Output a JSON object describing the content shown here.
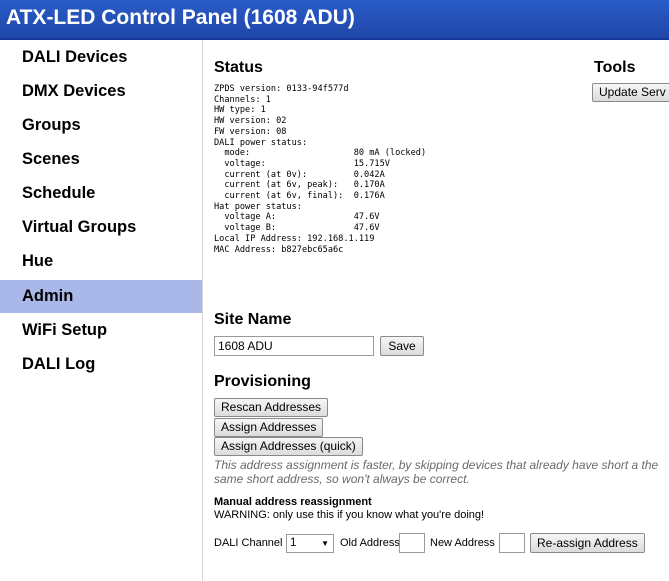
{
  "app": {
    "title": "ATX-LED Control Panel (1608 ADU)"
  },
  "sidebar": {
    "items": [
      {
        "label": "DALI Devices",
        "active": false
      },
      {
        "label": "DMX Devices",
        "active": false
      },
      {
        "label": "Groups",
        "active": false
      },
      {
        "label": "Scenes",
        "active": false
      },
      {
        "label": "Schedule",
        "active": false
      },
      {
        "label": "Virtual Groups",
        "active": false
      },
      {
        "label": "Hue",
        "active": false
      },
      {
        "label": "Admin",
        "active": true
      },
      {
        "label": "WiFi Setup",
        "active": false
      },
      {
        "label": "DALI Log",
        "active": false
      }
    ]
  },
  "status": {
    "heading": "Status",
    "text": "ZPDS version: 0133-94f577d\nChannels: 1\nHW type: 1\nHW version: 02\nFW version: 08\nDALI power status:\n  mode:                    80 mA (locked)\n  voltage:                 15.715V\n  current (at 0v):         0.042A\n  current (at 6v, peak):   0.170A\n  current (at 6v, final):  0.176A\nHat power status:\n  voltage A:               47.6V\n  voltage B:               47.6V\nLocal IP Address: 192.168.1.119\nMAC Address: b827ebc65a6c"
  },
  "tools": {
    "heading": "Tools",
    "update_button": "Update Serv"
  },
  "site_name": {
    "heading": "Site Name",
    "value": "1608 ADU",
    "save_button": "Save"
  },
  "provisioning": {
    "heading": "Provisioning",
    "rescan_button": "Rescan Addresses",
    "assign_button": "Assign Addresses",
    "assign_quick_button": "Assign Addresses (quick)",
    "quick_note": "This address assignment is faster, by skipping devices that already have short a the same short address, so won't always be correct."
  },
  "manual": {
    "heading": "Manual address reassignment",
    "warning": "WARNING: only use this if you know what you're doing!",
    "channel_label": "DALI Channel",
    "channel_value": "1",
    "old_label": "Old Address",
    "old_value": "",
    "new_label": "New Address",
    "new_value": "",
    "reassign_button": "Re-assign Address"
  }
}
